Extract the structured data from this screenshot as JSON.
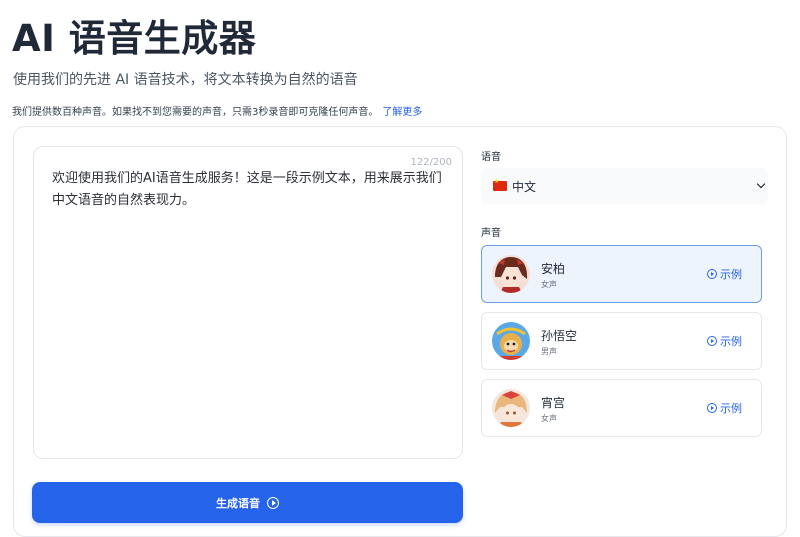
{
  "header": {
    "title": "AI 语音生成器",
    "subtitle": "使用我们的先进 AI 语音技术，将文本转换为自然的语音",
    "note": "我们提供数百种声音。如果找不到您需要的声音，只需3秒录音即可克隆任何声音。",
    "learn_more": "了解更多"
  },
  "editor": {
    "char_count": "122/200",
    "text": "欢迎使用我们的AI语音生成服务！这是一段示例文本，用来展示我们中文语音的自然表现力。"
  },
  "generate_button": {
    "label": "生成语音"
  },
  "language": {
    "label": "语音",
    "selected": "中文"
  },
  "voices": {
    "label": "声音",
    "items": [
      {
        "name": "安柏",
        "gender": "女声",
        "sample": "示例",
        "selected": true
      },
      {
        "name": "孙悟空",
        "gender": "男声",
        "sample": "示例",
        "selected": false
      },
      {
        "name": "宵宫",
        "gender": "女声",
        "sample": "示例",
        "selected": false
      }
    ]
  },
  "colors": {
    "accent": "#2563eb",
    "selected_bg": "#eef4fd",
    "selected_border": "#6e9ee6"
  }
}
